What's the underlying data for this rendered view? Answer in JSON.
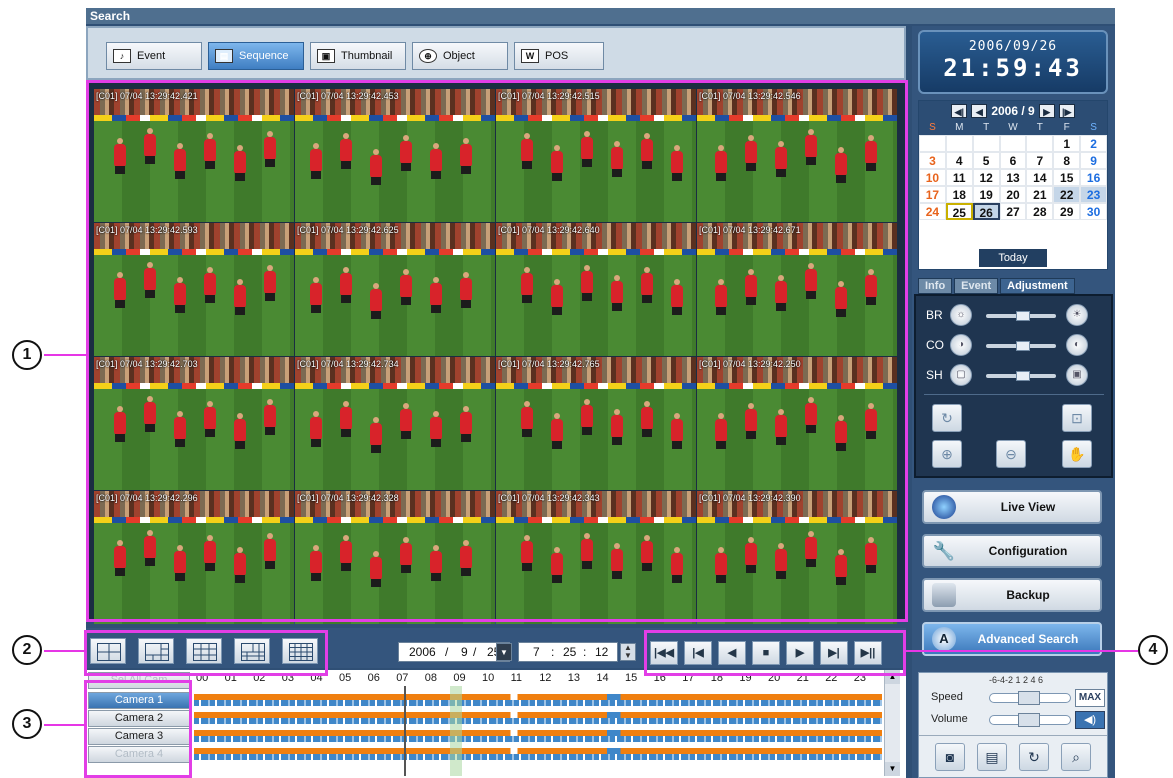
{
  "window": {
    "title": "Search"
  },
  "modes": [
    {
      "label": "Event",
      "icon": "bell-icon",
      "active": false
    },
    {
      "label": "Sequence",
      "icon": "sequence-icon",
      "active": true
    },
    {
      "label": "Thumbnail",
      "icon": "thumbnail-icon",
      "active": false
    },
    {
      "label": "Object",
      "icon": "target-icon",
      "active": false
    },
    {
      "label": "POS",
      "icon": "pos-icon",
      "active": false
    }
  ],
  "tiles": [
    "[C01] 07/04 13:29:42.421",
    "[C01] 07/04 13:29:42.453",
    "[C01] 07/04 13:29:42.515",
    "[C01] 07/04 13:29:42.546",
    "[C01] 07/04 13:29:42.593",
    "[C01] 07/04 13:29:42.625",
    "[C01] 07/04 13:29:42.640",
    "[C01] 07/04 13:29:42.671",
    "[C01] 07/04 13:29:42.703",
    "[C01] 07/04 13:29:42.734",
    "[C01] 07/04 13:29:42.765",
    "[C01] 07/04 13:29:42.250",
    "[C01] 07/04 13:29:42.296",
    "[C01] 07/04 13:29:42.328",
    "[C01] 07/04 13:29:42.343",
    "[C01] 07/04 13:29:42.390"
  ],
  "clock": {
    "date": "2006/09/26",
    "time": "21:59:43"
  },
  "calendar": {
    "header": "2006 / 9",
    "dow": [
      "S",
      "M",
      "T",
      "W",
      "T",
      "F",
      "S"
    ],
    "days": [
      "",
      "",
      "",
      "",
      "",
      "1",
      "2",
      "3",
      "4",
      "5",
      "6",
      "7",
      "8",
      "9",
      "10",
      "11",
      "12",
      "13",
      "14",
      "15",
      "16",
      "17",
      "18",
      "19",
      "20",
      "21",
      "22",
      "23",
      "24",
      "25",
      "26",
      "27",
      "28",
      "29",
      "30"
    ],
    "today_label": "Today"
  },
  "panel_tabs": [
    "Info",
    "Event",
    "Adjustment"
  ],
  "adjust": {
    "brightness": "BR",
    "contrast": "CO",
    "sharpness": "SH"
  },
  "actions": [
    {
      "label": "Live View",
      "icon": "globe-icon"
    },
    {
      "label": "Configuration",
      "icon": "wrench-icon"
    },
    {
      "label": "Backup",
      "icon": "database-icon"
    },
    {
      "label": "Advanced Search",
      "icon": "advanced-search-icon"
    }
  ],
  "speed": {
    "scale": "-6-4-2 1 2 4 6",
    "speed_label": "Speed",
    "volume_label": "Volume",
    "max_label": "MAX"
  },
  "datetime": {
    "year": "2006",
    "month": "9",
    "day": "25",
    "hour": "7",
    "minute": "25",
    "second": "12"
  },
  "timeline": {
    "select_all": "Sel All Cam",
    "hours": [
      "00",
      "01",
      "02",
      "03",
      "04",
      "05",
      "06",
      "07",
      "08",
      "09",
      "10",
      "11",
      "12",
      "13",
      "14",
      "15",
      "16",
      "17",
      "18",
      "19",
      "20",
      "21",
      "22",
      "23"
    ],
    "cameras": [
      "Camera 1",
      "Camera 2",
      "Camera 3",
      "Camera 4"
    ]
  },
  "callouts": [
    "1",
    "2",
    "3",
    "4"
  ]
}
